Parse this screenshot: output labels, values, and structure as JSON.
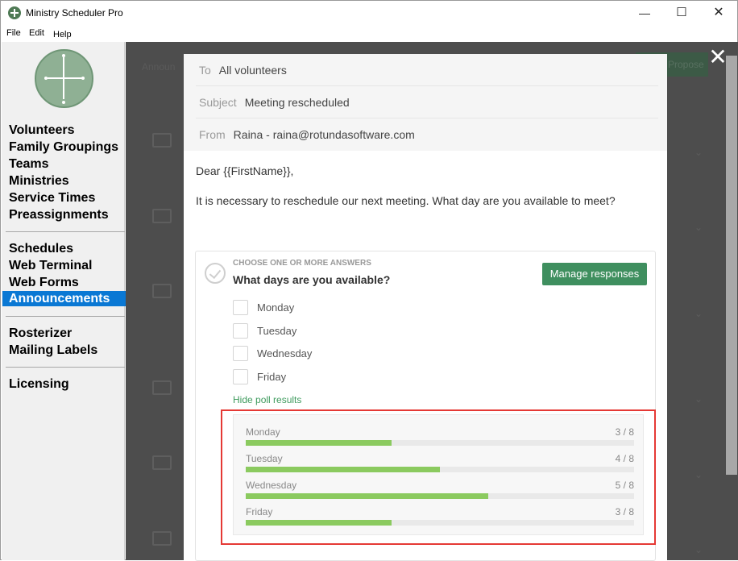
{
  "window": {
    "title": "Ministry Scheduler Pro"
  },
  "menu": [
    "File",
    "Edit",
    "Help"
  ],
  "sidebar": {
    "group1": [
      "Volunteers",
      "Family Groupings",
      "Teams",
      "Ministries",
      "Service Times",
      "Preassignments"
    ],
    "group2": [
      "Schedules",
      "Web Terminal",
      "Web Forms",
      "Announcements"
    ],
    "group3": [
      "Rosterizer",
      "Mailing Labels"
    ],
    "group4": [
      "Licensing"
    ],
    "active": "Announcements"
  },
  "background": {
    "tab_label": "Announ",
    "button_label": "Propose"
  },
  "message": {
    "to_label": "To",
    "to_value": "All volunteers",
    "subject_label": "Subject",
    "subject_value": "Meeting rescheduled",
    "from_label": "From",
    "from_value": "Raina - raina@rotundasoftware.com",
    "greeting": "Dear {{FirstName}},",
    "body": "It is necessary to reschedule our next meeting. What day are you available to meet?"
  },
  "poll": {
    "kind_label": "CHOOSE ONE OR MORE ANSWERS",
    "question": "What days are you available?",
    "manage_button": "Manage responses",
    "options": [
      "Monday",
      "Tuesday",
      "Wednesday",
      "Friday"
    ],
    "hide_results_link": "Hide poll results",
    "results": [
      {
        "name": "Monday",
        "count": "3 / 8",
        "fraction": 0.375
      },
      {
        "name": "Tuesday",
        "count": "4 / 8",
        "fraction": 0.5
      },
      {
        "name": "Wednesday",
        "count": "5 / 8",
        "fraction": 0.625
      },
      {
        "name": "Friday",
        "count": "3 / 8",
        "fraction": 0.375
      }
    ]
  },
  "colors": {
    "accent_green": "#3f8f5f",
    "bar_fill": "#8bca5f",
    "highlight": "#e53935",
    "nav_active": "#0a78d4"
  }
}
